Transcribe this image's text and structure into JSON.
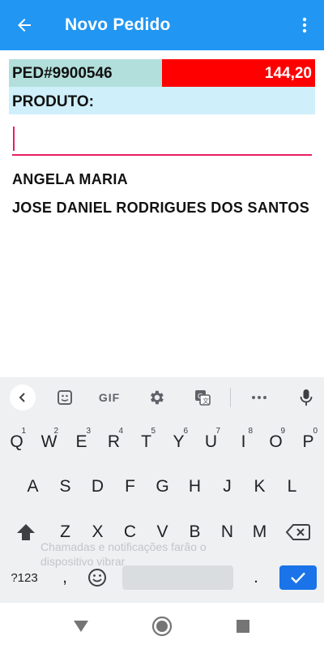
{
  "appbar": {
    "title": "Novo Pedido",
    "back_icon": "arrow-back-icon",
    "menu_icon": "more-vert-icon",
    "color": "#2196f3"
  },
  "order": {
    "id": "PED#9900546",
    "total": "144,20",
    "total_bg": "#ff0000",
    "id_bg": "#b2dfdb"
  },
  "product": {
    "label": "PRODUTO:",
    "input_value": ""
  },
  "clients": [
    "ANGELA MARIA",
    "JOSE DANIEL RODRIGUES DOS SANTOS"
  ],
  "keyboard": {
    "toolbar": {
      "gif_label": "GIF"
    },
    "row1": [
      {
        "k": "Q",
        "h": "1"
      },
      {
        "k": "W",
        "h": "2"
      },
      {
        "k": "E",
        "h": "3"
      },
      {
        "k": "R",
        "h": "4"
      },
      {
        "k": "T",
        "h": "5"
      },
      {
        "k": "Y",
        "h": "6"
      },
      {
        "k": "U",
        "h": "7"
      },
      {
        "k": "I",
        "h": "8"
      },
      {
        "k": "O",
        "h": "9"
      },
      {
        "k": "P",
        "h": "0"
      }
    ],
    "row2": [
      "A",
      "S",
      "D",
      "F",
      "G",
      "H",
      "J",
      "K",
      "L"
    ],
    "row3": [
      "Z",
      "X",
      "C",
      "V",
      "B",
      "N",
      "M"
    ],
    "symbols_label": "?123",
    "comma_label": ",",
    "period_label": ".",
    "notification_hint": "Chamadas e notificações farão o dispositivo vibrar",
    "enter_color": "#1a73e8"
  },
  "navbar": {
    "back_icon": "nav-back-icon",
    "home_icon": "nav-home-icon",
    "recents_icon": "nav-recents-icon"
  }
}
